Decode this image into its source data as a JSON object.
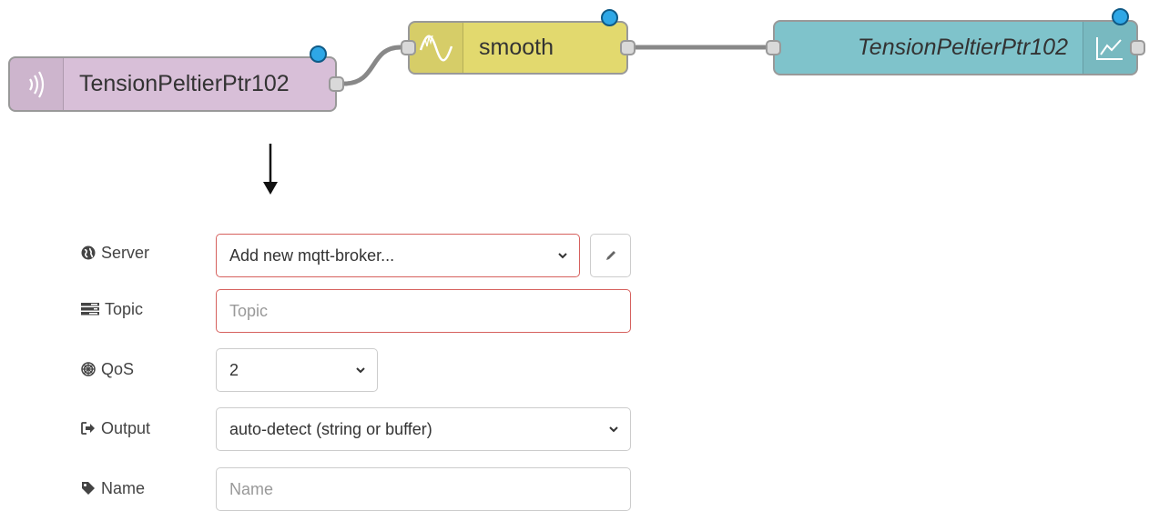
{
  "flow": {
    "nodes": [
      {
        "label": "TensionPeltierPtr102",
        "type": "mqtt in",
        "color": "#d8bfd8",
        "icon": "bridge-icon"
      },
      {
        "label": "smooth",
        "type": "smooth",
        "color": "#e2d96e",
        "icon": "smooth-wave-icon"
      },
      {
        "label": "TensionPeltierPtr102",
        "type": "ui_chart",
        "color": "#7fc3cb",
        "icon": "chart-icon"
      }
    ],
    "status_dot_color": "#2ea7e6",
    "wire_color": "#888888"
  },
  "form": {
    "server": {
      "label": "Server",
      "icon": "globe-icon",
      "value": "Add new mqtt-broker...",
      "edit_icon": "pencil-icon"
    },
    "topic": {
      "label": "Topic",
      "icon": "tasks-icon",
      "placeholder": "Topic",
      "value": ""
    },
    "qos": {
      "label": "QoS",
      "icon": "empire-icon",
      "value": "2"
    },
    "output": {
      "label": "Output",
      "icon": "sign-out-icon",
      "value": "auto-detect (string or buffer)"
    },
    "name": {
      "label": "Name",
      "icon": "tag-icon",
      "placeholder": "Name",
      "value": ""
    }
  }
}
